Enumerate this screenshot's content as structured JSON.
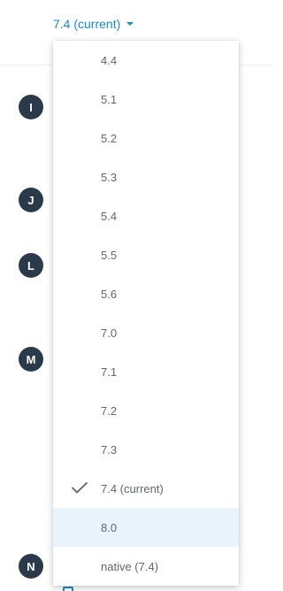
{
  "version_selector": {
    "label": "7.4 (current)",
    "icon": "caret-down-icon",
    "accent_color": "#1a8bc9"
  },
  "letter_index": [
    "I",
    "J",
    "L",
    "M",
    "N"
  ],
  "dropdown": {
    "selected": "7.4 (current)",
    "highlighted": "8.0",
    "highlight_color": "#e8f3fb",
    "items": [
      {
        "label": "4.4"
      },
      {
        "label": "5.1"
      },
      {
        "label": "5.2"
      },
      {
        "label": "5.3"
      },
      {
        "label": "5.4"
      },
      {
        "label": "5.5"
      },
      {
        "label": "5.6"
      },
      {
        "label": "7.0"
      },
      {
        "label": "7.1"
      },
      {
        "label": "7.2"
      },
      {
        "label": "7.3"
      },
      {
        "label": "7.4 (current)",
        "checked": true,
        "icon": "checkmark-icon"
      },
      {
        "label": "8.0",
        "highlighted": true
      },
      {
        "label": "native (7.4)"
      }
    ]
  }
}
